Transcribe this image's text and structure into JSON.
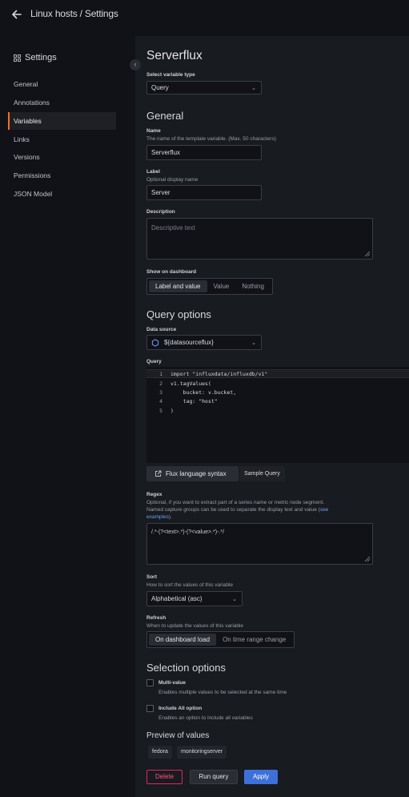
{
  "header": {
    "title": "Linux hosts / Settings"
  },
  "sidebar": {
    "title": "Settings",
    "items": [
      {
        "label": "General"
      },
      {
        "label": "Annotations"
      },
      {
        "label": "Variables"
      },
      {
        "label": "Links"
      },
      {
        "label": "Versions"
      },
      {
        "label": "Permissions"
      },
      {
        "label": "JSON Model"
      }
    ]
  },
  "page": {
    "title": "Serverflux"
  },
  "variable_type": {
    "label": "Select variable type",
    "value": "Query"
  },
  "general": {
    "heading": "General",
    "name_label": "Name",
    "name_desc": "The name of the template variable. (Max. 50 characters)",
    "name_value": "Serverflux",
    "label_label": "Label",
    "label_desc": "Optional display name",
    "label_value": "Server",
    "description_label": "Description",
    "description_placeholder": "Descriptive text",
    "show_label": "Show on dashboard",
    "show_options": [
      "Label and value",
      "Value",
      "Nothing"
    ]
  },
  "query_options": {
    "heading": "Query options",
    "datasource_label": "Data source",
    "datasource_value": "${datasourceflux}",
    "query_label": "Query",
    "code_lines": [
      {
        "n": "1",
        "text": "import \"influxdata/influxdb/v1\""
      },
      {
        "n": "2",
        "text": "v1.tagValues("
      },
      {
        "n": "3",
        "text": "    bucket: v.bucket,"
      },
      {
        "n": "4",
        "text": "    tag: \"host\""
      },
      {
        "n": "5",
        "text": ")"
      }
    ],
    "flux_syntax_button": "Flux language syntax",
    "sample_query_button": "Sample Query",
    "regex_label": "Regex",
    "regex_desc_1": "Optional, if you want to extract part of a series name or metric node segment.",
    "regex_desc_2": "Named capture groups can be used to separate the display text and value (",
    "regex_desc_link": "see",
    "regex_desc_link2": "examples",
    "regex_desc_end": ").",
    "regex_value": "/.*-(?<text>.*)-(?<value>.*)-.*/",
    "sort_label": "Sort",
    "sort_desc": "How to sort the values of this variable",
    "sort_value": "Alphabetical (asc)",
    "refresh_label": "Refresh",
    "refresh_desc": "When to update the values of this variable",
    "refresh_options": [
      "On dashboard load",
      "On time range change"
    ]
  },
  "selection": {
    "heading": "Selection options",
    "multi_label": "Multi-value",
    "multi_desc": "Enables multiple values to be selected at the same time",
    "includeall_label": "Include All option",
    "includeall_desc": "Enables an option to include all variables"
  },
  "preview": {
    "heading": "Preview of values",
    "values": [
      "fedora",
      "monitoringserver"
    ]
  },
  "actions": {
    "delete": "Delete",
    "run_query": "Run query",
    "apply": "Apply"
  },
  "colors": {
    "accent": "#f46f20",
    "apply": "#3d71d9",
    "delete": "#e0226e"
  }
}
